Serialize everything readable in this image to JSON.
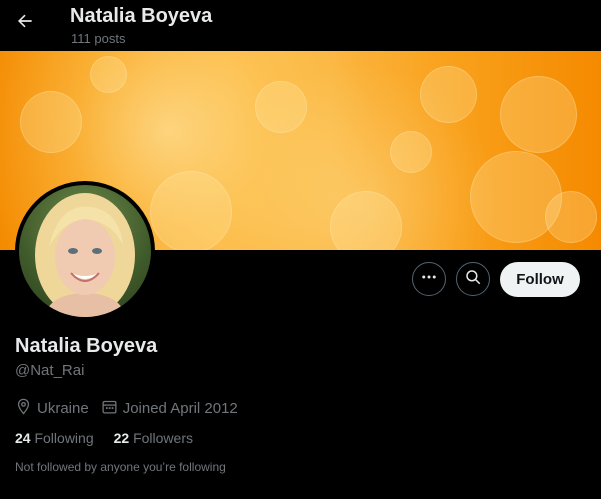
{
  "header": {
    "title": "Natalia Boyeva",
    "posts": "111 posts"
  },
  "profile": {
    "name": "Natalia Boyeva",
    "handle": "@Nat_Rai",
    "location": "Ukraine",
    "joined": "Joined April 2012",
    "following_count": "24",
    "following_label": "Following",
    "followers_count": "22",
    "followers_label": "Followers",
    "not_followed_text": "Not followed by anyone you’re following"
  },
  "actions": {
    "follow_label": "Follow"
  },
  "icons": {
    "back": "arrow-left-icon",
    "more": "more-dots-icon",
    "search": "search-icon",
    "location": "location-pin-icon",
    "calendar": "calendar-icon"
  },
  "colors": {
    "background": "#000000",
    "text_primary": "#e7e9ea",
    "text_secondary": "#71767b",
    "follow_button_bg": "#eff3f4",
    "banner_orange": "#f9a21c"
  }
}
